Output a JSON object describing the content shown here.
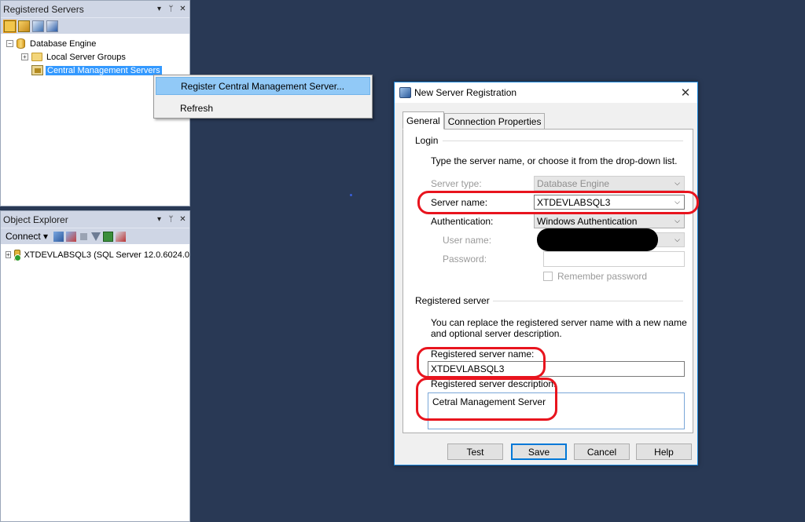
{
  "registered_servers": {
    "title": "Registered Servers",
    "pin_glyph": "▾ ⫫ ✕",
    "tree": {
      "root": "Database Engine",
      "children": [
        "Local Server Groups",
        "Central Management Servers"
      ]
    }
  },
  "context_menu": {
    "items": [
      "Register Central Management Server...",
      "Refresh"
    ]
  },
  "object_explorer": {
    "title": "Object Explorer",
    "connect_label": "Connect ▾",
    "server_node": "XTDEVLABSQL3 (SQL Server 12.0.6024.0"
  },
  "dialog": {
    "title": "New Server Registration",
    "close_glyph": "✕",
    "tabs": [
      "General",
      "Connection Properties"
    ],
    "login": {
      "group_label": "Login",
      "instruction": "Type the server name, or choose it from the drop-down list.",
      "server_type_label": "Server type:",
      "server_type_value": "Database Engine",
      "server_name_label": "Server name:",
      "server_name_value": "XTDEVLABSQL3",
      "authentication_label": "Authentication:",
      "authentication_value": "Windows Authentication",
      "user_name_label": "User name:",
      "password_label": "Password:",
      "remember_password_label": "Remember password"
    },
    "registered": {
      "group_label": "Registered server",
      "instruction_line1": "You can replace the registered server name with a new name",
      "instruction_line2": "and optional server description.",
      "name_label": "Registered server name:",
      "name_value": "XTDEVLABSQL3",
      "description_label": "Registered server description:",
      "description_value": "Cetral Management Server"
    },
    "buttons": {
      "test": "Test",
      "save": "Save",
      "cancel": "Cancel",
      "help": "Help"
    }
  },
  "colors": {
    "desktop_bg": "#293955",
    "annotation_red": "#e8141e",
    "selection_blue": "#3399ff"
  }
}
